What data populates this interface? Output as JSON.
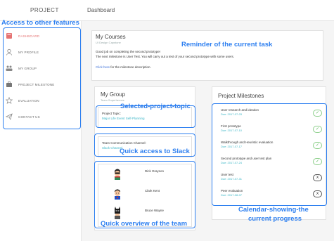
{
  "app": {
    "brand": "PROJECT",
    "page_title": "Dashboard"
  },
  "sidebar": {
    "items": [
      {
        "label": "DASHBOARD",
        "icon": "book-icon",
        "active": true
      },
      {
        "label": "MY PROFILE",
        "icon": "user-icon"
      },
      {
        "label": "MY GROUP",
        "icon": "group-icon"
      },
      {
        "label": "PROJECT MILESTONE",
        "icon": "briefcase-icon"
      },
      {
        "label": "EVALUATION",
        "icon": "star-icon"
      },
      {
        "label": "CONTACT US",
        "icon": "send-icon"
      }
    ]
  },
  "courses": {
    "title": "My Courses",
    "subtitle": "UI Design Capstone",
    "line1": "Good job on completing the second prototype!",
    "line2": "The next milestone is User Test. You will carry out a test of your second prototype with some users.",
    "link_text": "Click here",
    "link_suffix": " for the milestone description."
  },
  "group": {
    "title": "My Group",
    "subtitle": "Team Superheroes",
    "topic_label": "Project Topic:",
    "topic_value": "Major Life Event Self-Planning",
    "channel_label": "Team Communication Channel:",
    "channel_value": "Slack Channel",
    "members": [
      "Dick Grayson",
      "Clark Kent",
      "Bruce Wayne"
    ]
  },
  "milestones": {
    "title": "Project Milestones",
    "items": [
      {
        "title": "User research and ideation",
        "due": "Due: 2017-07-03",
        "done": true
      },
      {
        "title": "First prototype",
        "due": "Due: 2017-07-10",
        "done": true
      },
      {
        "title": "Walkthrough and Heuristic evaluation",
        "due": "Due: 2017-07-17",
        "done": true
      },
      {
        "title": "Second prototype and user test plan",
        "due": "Due: 2017-07-24",
        "done": true
      },
      {
        "title": "User test",
        "due": "Due: 2017-07-31",
        "done": false
      },
      {
        "title": "Peer evaluation",
        "due": "Due: 2017-08-07",
        "done": false
      }
    ],
    "done_symbol": "✓",
    "todo_symbol": "X"
  },
  "annotations": {
    "features": "Access to other features",
    "reminder": "Reminder of the current task",
    "topic": "Selected-project-topic",
    "slack": "Quick access to Slack",
    "team": "Quick overview of the team",
    "calendar_line1": "Calendar-showing-the",
    "calendar_line2": "current progress"
  },
  "colors": {
    "accent": "#2d7ff0",
    "active_nav": "#e57373",
    "done_green": "#5cb85c",
    "link": "#3b6fd8"
  }
}
